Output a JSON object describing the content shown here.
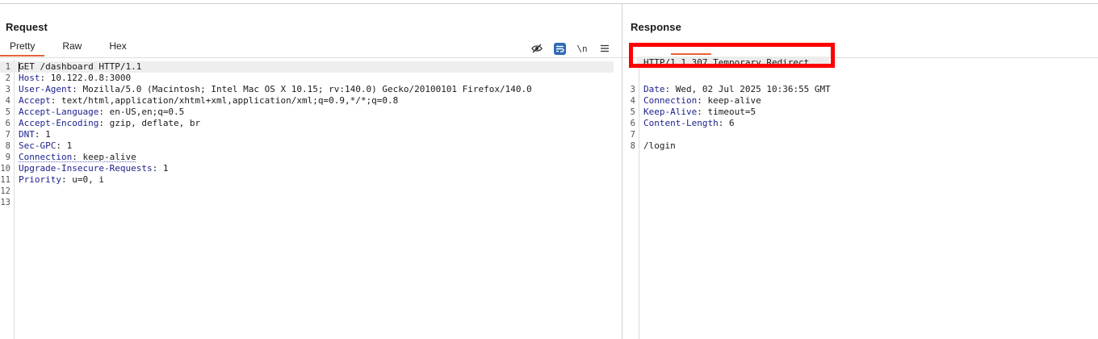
{
  "request": {
    "title": "Request",
    "tabs": [
      "Pretty",
      "Raw",
      "Hex"
    ],
    "toolbar": {
      "newline_label": "\\n"
    },
    "lines": [
      {
        "n": "1",
        "name": "",
        "value": "GET /dashboard HTTP/1.1"
      },
      {
        "n": "2",
        "name": "Host",
        "value": ": 10.122.0.8:3000"
      },
      {
        "n": "3",
        "name": "User-Agent",
        "value": ": Mozilla/5.0 (Macintosh; Intel Mac OS X 10.15; rv:140.0) Gecko/20100101 Firefox/140.0"
      },
      {
        "n": "4",
        "name": "Accept",
        "value": ": text/html,application/xhtml+xml,application/xml;q=0.9,*/*;q=0.8"
      },
      {
        "n": "5",
        "name": "Accept-Language",
        "value": ": en-US,en;q=0.5"
      },
      {
        "n": "6",
        "name": "Accept-Encoding",
        "value": ": gzip, deflate, br"
      },
      {
        "n": "7",
        "name": "DNT",
        "value": ": 1"
      },
      {
        "n": "8",
        "name": "Sec-GPC",
        "value": ": 1"
      },
      {
        "n": "9",
        "name": "Connection",
        "value": ": keep-alive"
      },
      {
        "n": "10",
        "name": "Upgrade-Insecure-Requests",
        "value": ": 1"
      },
      {
        "n": "11",
        "name": "Priority",
        "value": ": u=0, i"
      },
      {
        "n": "12",
        "name": "",
        "value": ""
      },
      {
        "n": "13",
        "name": "",
        "value": ""
      }
    ]
  },
  "response": {
    "title": "Response",
    "status_line": "HTTP/1.1 307 Temporary Redirect",
    "lines": [
      {
        "n": "3",
        "name": "Date",
        "value": ": Wed, 02 Jul 2025 10:36:55 GMT"
      },
      {
        "n": "4",
        "name": "Connection",
        "value": ": keep-alive"
      },
      {
        "n": "5",
        "name": "Keep-Alive",
        "value": ": timeout=5"
      },
      {
        "n": "6",
        "name": "Content-Length",
        "value": ": 6"
      },
      {
        "n": "7",
        "name": "",
        "value": ""
      },
      {
        "n": "8",
        "name": "",
        "value": "/login"
      }
    ]
  },
  "colors": {
    "accent": "#e8643a",
    "header_name": "#1a1f8c",
    "highlight": "#ff0000"
  }
}
